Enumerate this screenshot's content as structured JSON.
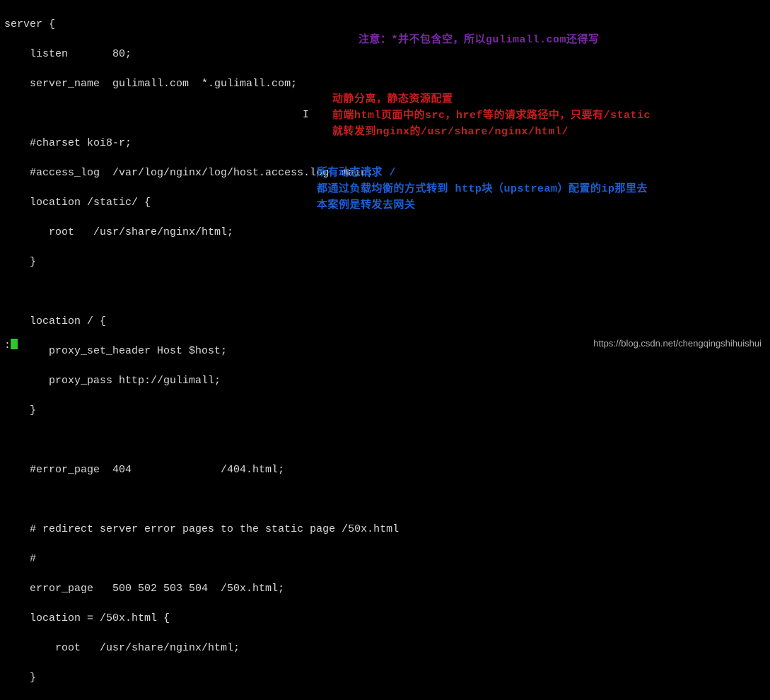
{
  "code": {
    "l1": "server {",
    "l2": "    listen       80;",
    "l3": "    server_name  gulimall.com  *.gulimall.com;",
    "l4": "",
    "l5": "    #charset koi8-r;",
    "l6": "    #access_log  /var/log/nginx/log/host.access.log  main;",
    "l7": "    location /static/ {",
    "l8": "       root   /usr/share/nginx/html;",
    "l9": "    }",
    "l10": "",
    "l11": "    location / {",
    "l12": "       proxy_set_header Host $host;",
    "l13": "       proxy_pass http://gulimall;",
    "l14": "    }",
    "l15": "",
    "l16": "    #error_page  404              /404.html;",
    "l17": "",
    "l18": "    # redirect server error pages to the static page /50x.html",
    "l19": "    #",
    "l20": "    error_page   500 502 503 504  /50x.html;",
    "l21": "    location = /50x.html {",
    "l22": "        root   /usr/share/nginx/html;",
    "l23": "    }"
  },
  "annotations": {
    "note1": "注意：*并不包含空，所以gulimall.com还得写",
    "red1": "动静分离，静态资源配置",
    "red2": "前端html页面中的src，href等的请求路径中，只要有/static",
    "red3": "就转发到nginx的/usr/share/nginx/html/",
    "blue1": "所有动态请求   /",
    "blue2": "都通过负载均衡的方式转到 http块（upstream）配置的ip那里去",
    "blue3": "本案例是转发去网关"
  },
  "cursor_char": "I",
  "prompt": ":",
  "watermark": "https://blog.csdn.net/chengqingshihuishui"
}
